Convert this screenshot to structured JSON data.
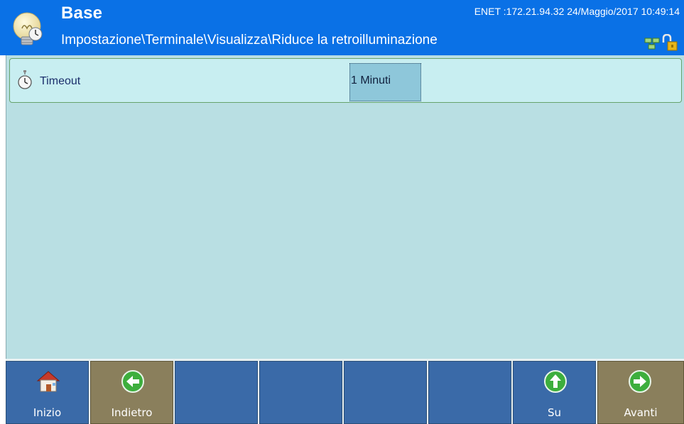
{
  "header": {
    "title": "Base",
    "path": "Impostazione\\Terminale\\Visualizza\\Riduce la retroilluminazione",
    "status": "ENET :172.21.94.32 24/Maggio/2017 10:49:14",
    "icons": [
      "lightbulb-icon",
      "network-icon",
      "lock-icon"
    ]
  },
  "setting": {
    "label": "Timeout",
    "value": "1 Minuti",
    "icon": "stopwatch-icon"
  },
  "softkeys": [
    {
      "label": "Inizio",
      "icon": "home-icon"
    },
    {
      "label": "Indietro",
      "icon": "arrow-left-icon"
    },
    {
      "label": ""
    },
    {
      "label": ""
    },
    {
      "label": ""
    },
    {
      "label": ""
    },
    {
      "label": "Su",
      "icon": "arrow-up-icon"
    },
    {
      "label": "Avanti",
      "icon": "arrow-right-icon"
    }
  ],
  "colors": {
    "header_bg": "#0a71e6",
    "content_bg": "#b9dfe3",
    "row_bg": "#c8eef1",
    "value_bg": "#8ec7da",
    "key_blue": "#3a6aa8",
    "key_olive": "#8a7f5c"
  }
}
